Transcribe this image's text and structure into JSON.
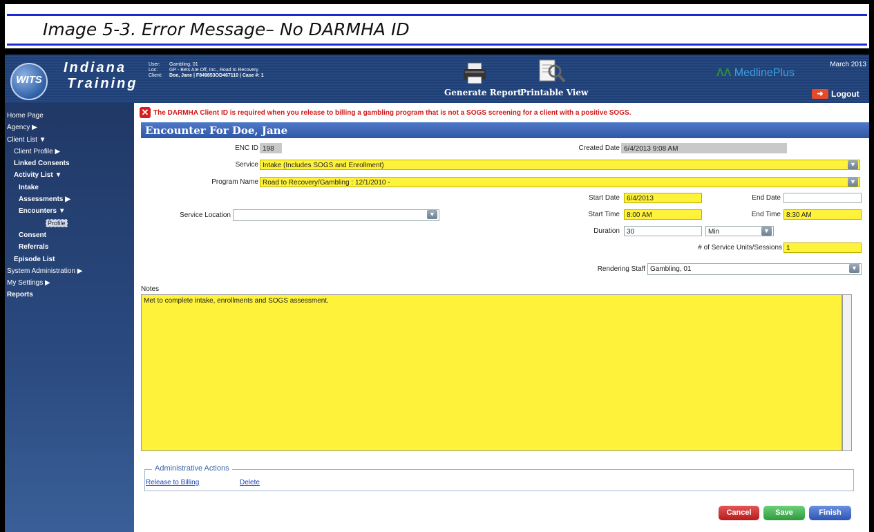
{
  "caption": "Image 5-3. Error Message– No DARMHA ID",
  "header": {
    "logo_text": "WITS",
    "brand_line1": "Indiana",
    "brand_line2": "Training",
    "user_label": "User:",
    "user_value": "Gambling, 01",
    "loc_label": "Loc:",
    "loc_value": "GP - Bets Are Off, Inc., Road to Recovery",
    "client_label": "Client:",
    "client_value": "Doe, Jane | F849853OD467110 | Case #: 1",
    "generate_report": "Generate Report",
    "printable_view": "Printable View",
    "medline": "MedlinePlus",
    "month": "March 2013",
    "logout": "Logout"
  },
  "sidebar": {
    "items": [
      {
        "label": "Home Page"
      },
      {
        "label": "Agency ▶"
      },
      {
        "label": "Client List ▼"
      },
      {
        "label": "Client Profile ▶"
      },
      {
        "label": "Linked Consents"
      },
      {
        "label": "Activity List ▼"
      },
      {
        "label": "Intake"
      },
      {
        "label": "Assessments ▶"
      },
      {
        "label": "Encounters ▼"
      },
      {
        "label": "Profile"
      },
      {
        "label": "Consent"
      },
      {
        "label": "Referrals"
      },
      {
        "label": "Episode List"
      },
      {
        "label": "System Administration ▶"
      },
      {
        "label": "My Settings ▶"
      },
      {
        "label": "Reports"
      }
    ]
  },
  "error_message": "The DARMHA Client ID is required when you release to billing a gambling program that is not a SOGS screening for a client with a positive SOGS.",
  "page_title": "Encounter For Doe, Jane",
  "form": {
    "enc_id_label": "ENC ID",
    "enc_id_value": "198",
    "created_date_label": "Created Date",
    "created_date_value": "6/4/2013 9:08 AM",
    "service_label": "Service",
    "service_value": "Intake (Includes SOGS and Enrollment)",
    "program_label": "Program Name",
    "program_value": "Road to Recovery/Gambling : 12/1/2010 -",
    "start_date_label": "Start Date",
    "start_date_value": "6/4/2013",
    "end_date_label": "End Date",
    "end_date_value": "",
    "service_location_label": "Service Location",
    "service_location_value": "",
    "start_time_label": "Start Time",
    "start_time_value": "8:00 AM",
    "end_time_label": "End Time",
    "end_time_value": "8:30 AM",
    "duration_label": "Duration",
    "duration_value": "30",
    "duration_unit": "Min",
    "units_label": "# of Service Units/Sessions",
    "units_value": "1",
    "rendering_staff_label": "Rendering Staff",
    "rendering_staff_value": "Gambling, 01",
    "notes_label": "Notes",
    "notes_value": "Met to complete intake, enrollments and SOGS assessment."
  },
  "admin": {
    "legend": "Administrative Actions",
    "release": "Release to Billing",
    "delete": "Delete"
  },
  "buttons": {
    "cancel": "Cancel",
    "save": "Save",
    "finish": "Finish"
  },
  "colors": {
    "required_field": "#fff23a",
    "header_blue": "#1f3f76",
    "error_red": "#d41616"
  }
}
